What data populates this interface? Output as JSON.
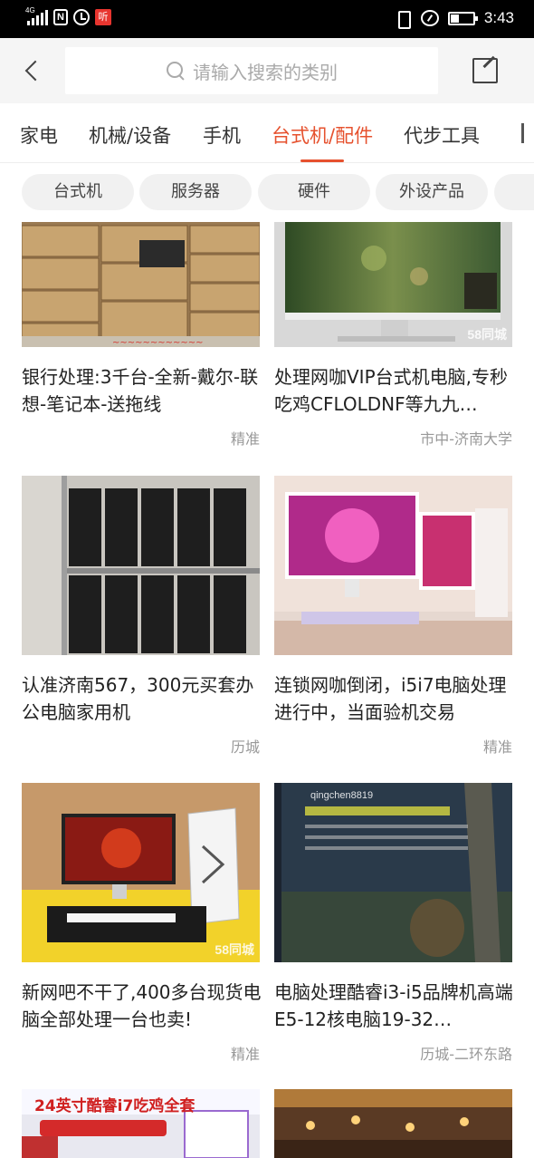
{
  "status_bar": {
    "network": "4G",
    "app_badge": "听",
    "time": "3:43"
  },
  "search": {
    "placeholder": "请输入搜索的类别"
  },
  "category_tabs": [
    "家电",
    "机械/设备",
    "手机",
    "台式机/配件",
    "代步工具"
  ],
  "active_tab": "台式机/配件",
  "filter_chips": [
    "台式机",
    "服务器",
    "硬件",
    "外设产品"
  ],
  "listings": [
    {
      "title": "银行处理:3千台-全新-戴尔-联想-笔记本-送拖线",
      "location": "精准",
      "watermark": ""
    },
    {
      "title": "处理网咖VIP台式机电脑,专秒吃鸡CFLOLDNF等九九…",
      "location": "市中-济南大学",
      "watermark": "58同城"
    },
    {
      "title": "认准济南567，300元买套办公电脑家用机",
      "location": "历城",
      "watermark": ""
    },
    {
      "title": "连锁网咖倒闭，i5i7电脑处理进行中，当面验机交易",
      "location": "精准",
      "watermark": ""
    },
    {
      "title": "新网吧不干了,400多台现货电脑全部处理一台也卖!",
      "location": "精准",
      "watermark": "58同城"
    },
    {
      "title": "电脑处理酷睿i3-i5品牌机高端E5-12核电脑19-32…",
      "location": "历城-二环东路",
      "watermark": "qingchen8819"
    },
    {
      "title": "24英寸酷睿i7吃鸡全套",
      "location": "",
      "watermark": ""
    },
    {
      "title": "",
      "location": "",
      "watermark": ""
    }
  ]
}
